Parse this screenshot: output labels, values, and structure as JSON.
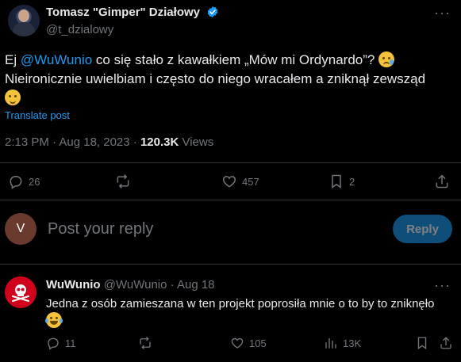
{
  "tweet": {
    "author_name": "Tomasz \"Gimper\" Działowy",
    "author_handle": "@t_dzialowy",
    "text_prefix": "Ej ",
    "mention": "@WuWunio",
    "text_line1_rest": " co się stało z kawałkiem „Mów mi Ordynardo”?",
    "text_line2": "Nieironicznie uwielbiam i często do niego wracałem a zniknął zewsząd",
    "translate_label": "Translate post",
    "time": "2:13 PM · Aug 18, 2023 · ",
    "views_count": "120.3K",
    "views_label": " Views",
    "actions": {
      "replies": "26",
      "likes": "457",
      "bookmarks": "2"
    }
  },
  "composer": {
    "avatar_letter": "V",
    "placeholder": "Post your reply",
    "reply_button": "Reply"
  },
  "reply": {
    "author_name": "WuWunio",
    "author_handle": "@WuWunio",
    "time": " · Aug 18",
    "text": "Jedna z osób zamieszana w ten projekt poprosiła mnie o to by to zniknęło",
    "actions": {
      "replies": "11",
      "likes": "105",
      "views": "13K"
    }
  },
  "colors": {
    "background": "#000000",
    "text": "#e7e9ea",
    "muted": "#71767b",
    "accent": "#1d9bf0",
    "divider": "#2f3336"
  }
}
